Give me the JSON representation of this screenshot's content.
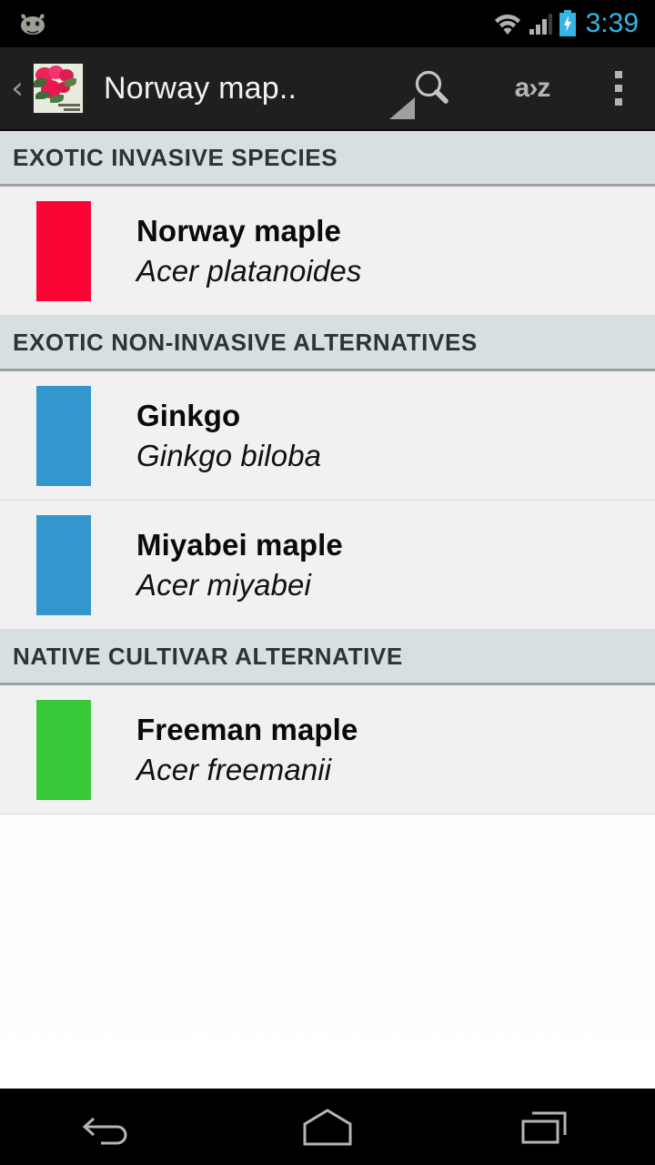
{
  "status_bar": {
    "clock": "3:39",
    "clock_color": "#33b5e5",
    "icons": [
      "cyanogenmod-icon",
      "wifi-icon",
      "signal-icon",
      "battery-charging-icon"
    ]
  },
  "action_bar": {
    "back_label": "‹",
    "app_icon_name": "roses-photo-icon",
    "title": "Norway map..",
    "dropdown_name": "spinner-dropdown-triangle",
    "search_label": "search-icon",
    "sort_label": "a›z",
    "overflow_label": "overflow-menu-icon"
  },
  "sections": [
    {
      "header": "EXOTIC INVASIVE SPECIES",
      "items": [
        {
          "common_name": "Norway maple",
          "latin_name": "Acer platanoides",
          "swatch_color": "#fb0334"
        }
      ]
    },
    {
      "header": "EXOTIC NON-INVASIVE ALTERNATIVES",
      "items": [
        {
          "common_name": "Ginkgo",
          "latin_name": "Ginkgo biloba",
          "swatch_color": "#3397cd"
        },
        {
          "common_name": "Miyabei maple",
          "latin_name": "Acer miyabei",
          "swatch_color": "#3397cd"
        }
      ]
    },
    {
      "header": "NATIVE CULTIVAR ALTERNATIVE",
      "items": [
        {
          "common_name": "Freeman maple",
          "latin_name": "Acer freemanii",
          "swatch_color": "#38c938"
        }
      ]
    }
  ],
  "nav_bar": {
    "back": "back-icon",
    "home": "home-icon",
    "recents": "recent-apps-icon"
  },
  "colors": {
    "section_header_bg": "#d7dfe1",
    "list_item_bg": "#f1f1f1",
    "action_bar_bg": "#1f1f1f",
    "accent_blue": "#33b5e5"
  }
}
